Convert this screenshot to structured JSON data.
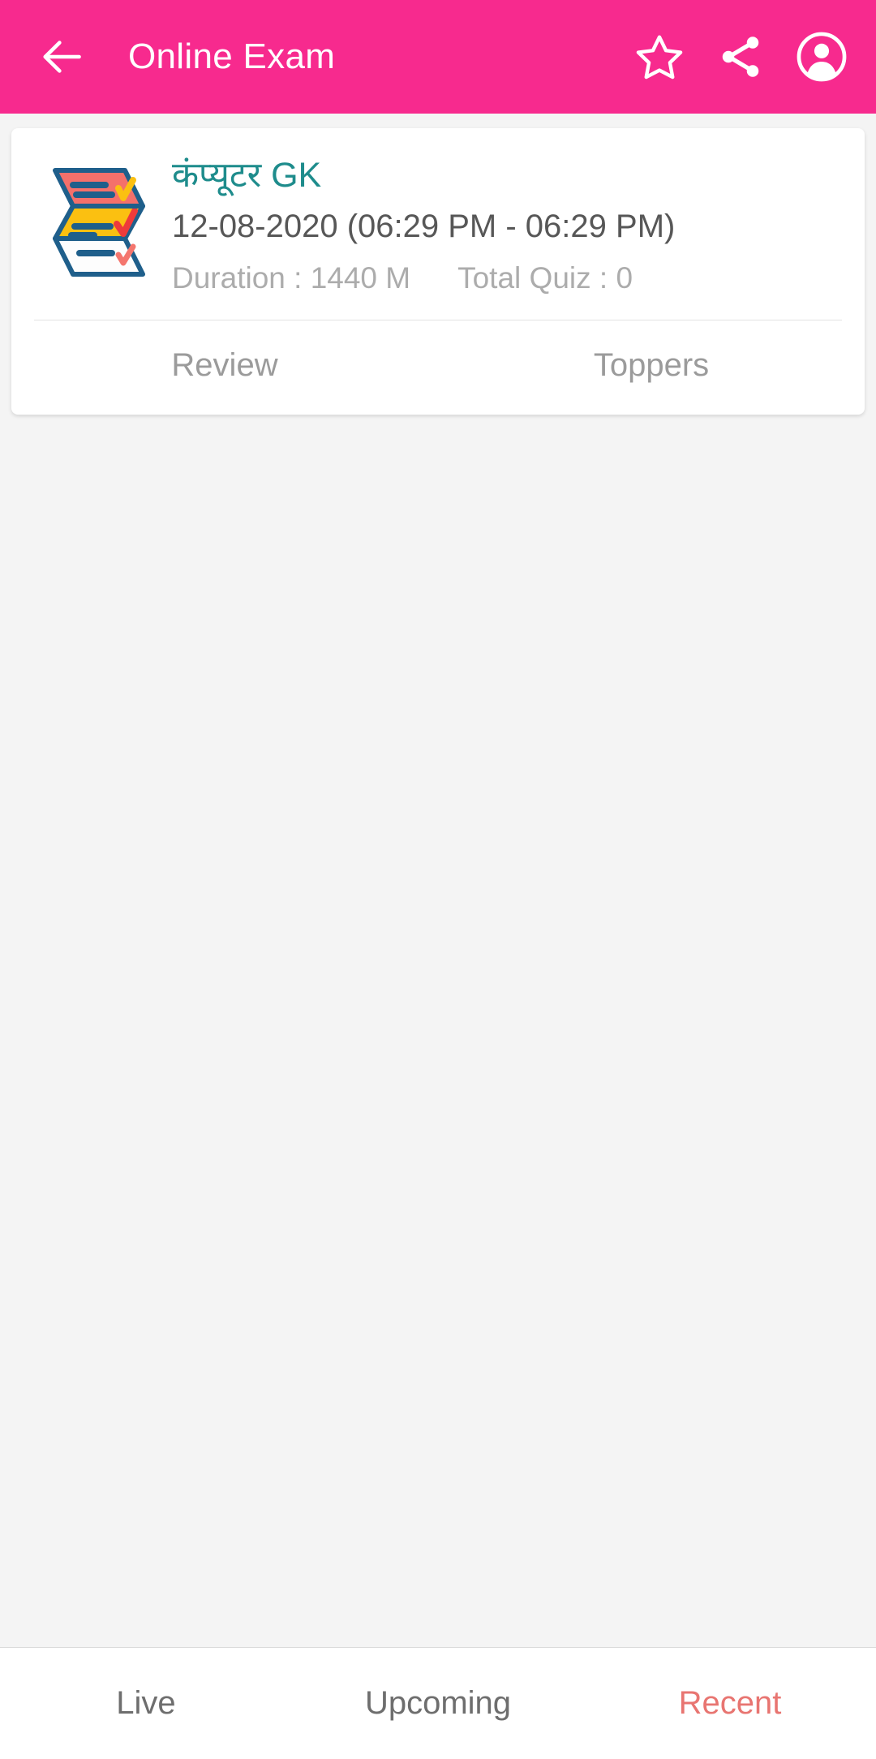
{
  "appbar": {
    "title": "Online Exam",
    "back_icon": "arrow-left-icon",
    "actions": [
      {
        "name": "favorite-star-icon",
        "label": "Favorite"
      },
      {
        "name": "share-icon",
        "label": "Share"
      },
      {
        "name": "account-circle-icon",
        "label": "Account"
      }
    ],
    "background_color": "#F72A8E",
    "foreground_color": "#FFFFFF"
  },
  "card": {
    "thumbnail_icon": "exam-sheets-icon",
    "title": "कंप्यूटर GK",
    "title_color": "#1E8C8C",
    "datetime": "12-08-2020 (06:29 PM - 06:29 PM)",
    "duration": "Duration : 1440 M",
    "total_quiz": "Total Quiz : 0",
    "actions": {
      "review": "Review",
      "toppers": "Toppers"
    }
  },
  "bottom_nav": {
    "items": [
      {
        "label": "Live",
        "active": false
      },
      {
        "label": "Upcoming",
        "active": false
      },
      {
        "label": "Recent",
        "active": true
      }
    ],
    "active_color": "#E87571",
    "inactive_color": "#6E6E6E"
  },
  "colors": {
    "page_background": "#F4F4F4",
    "card_background": "#FFFFFF",
    "accent_pink": "#F72A8E",
    "teal": "#1E8C8C",
    "coral": "#E87571"
  }
}
